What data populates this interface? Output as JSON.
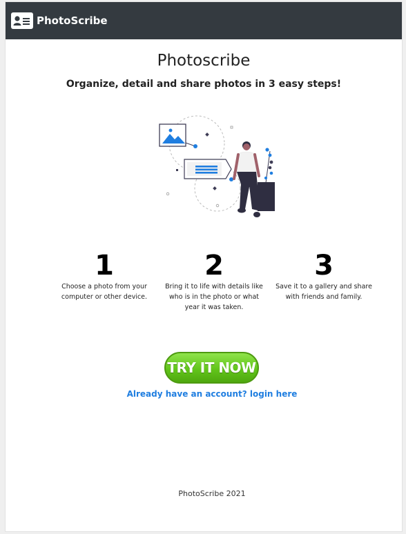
{
  "navbar": {
    "brand_name": "PhotoScribe",
    "brand_icon": "contact-card-icon"
  },
  "hero": {
    "title": "Photoscribe",
    "subtitle": "Organize, detail and share photos in 3 easy steps!",
    "illustration": "person-with-photo-and-notes-illustration"
  },
  "steps": [
    {
      "number": "1",
      "text": "Choose a photo from your computer or other device."
    },
    {
      "number": "2",
      "text": "Bring it to life with details like who is in the photo or what year it was taken."
    },
    {
      "number": "3",
      "text": "Save it to a gallery and share with friends and family."
    }
  ],
  "cta": {
    "try_label": "TRY IT NOW",
    "login_label": "Already have an account? login here"
  },
  "footer": {
    "text": "PhotoScribe 2021"
  },
  "colors": {
    "navbar_bg": "#343a40",
    "accent_blue": "#1f7ee0",
    "cta_green": "#62c51b",
    "illustration_dark": "#2f2e41"
  }
}
